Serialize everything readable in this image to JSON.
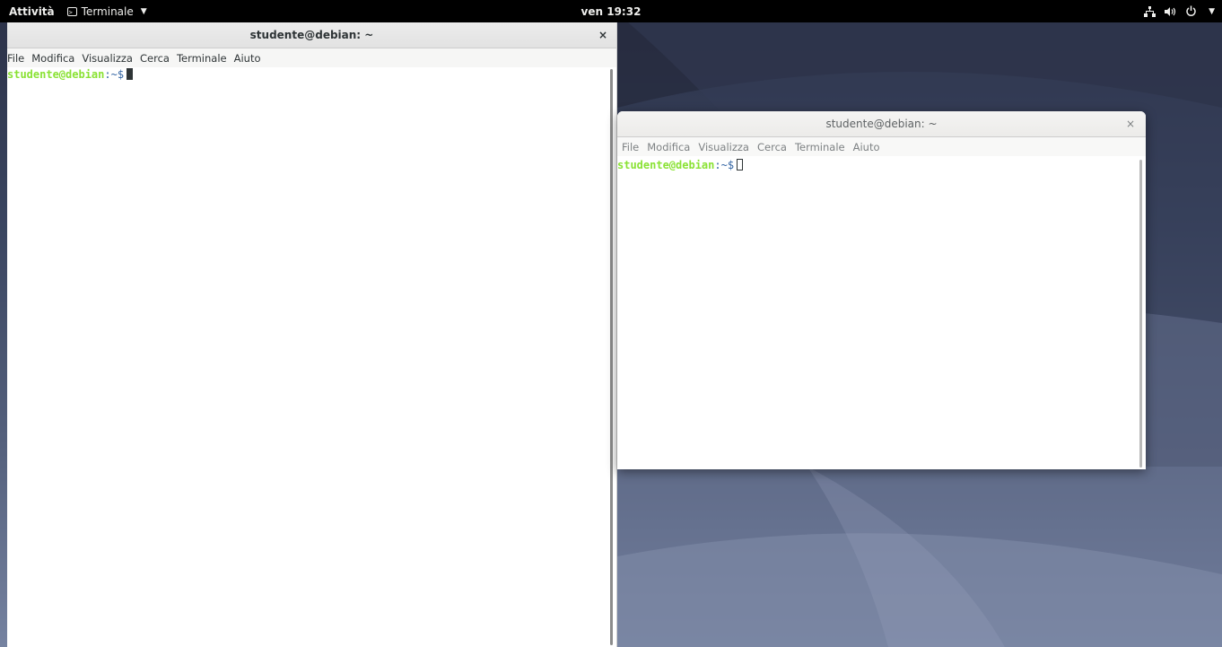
{
  "topbar": {
    "activities": "Attività",
    "app_menu": "Terminale",
    "clock": "ven 19:32"
  },
  "windows": [
    {
      "title": "studente@debian: ~",
      "menu": [
        "File",
        "Modifica",
        "Visualizza",
        "Cerca",
        "Terminale",
        "Aiuto"
      ],
      "prompt_user": "studente@debian",
      "prompt_path": ":~$",
      "focused": true
    },
    {
      "title": "studente@debian: ~",
      "menu": [
        "File",
        "Modifica",
        "Visualizza",
        "Cerca",
        "Terminale",
        "Aiuto"
      ],
      "prompt_user": "studente@debian",
      "prompt_path": ":~$",
      "focused": false
    }
  ],
  "icons": {
    "close": "×",
    "network": "network-icon",
    "volume": "volume-icon",
    "power": "power-icon"
  },
  "colors": {
    "prompt_user": "#8ae234",
    "prompt_path": "#3465a4",
    "topbar": "#000000"
  }
}
